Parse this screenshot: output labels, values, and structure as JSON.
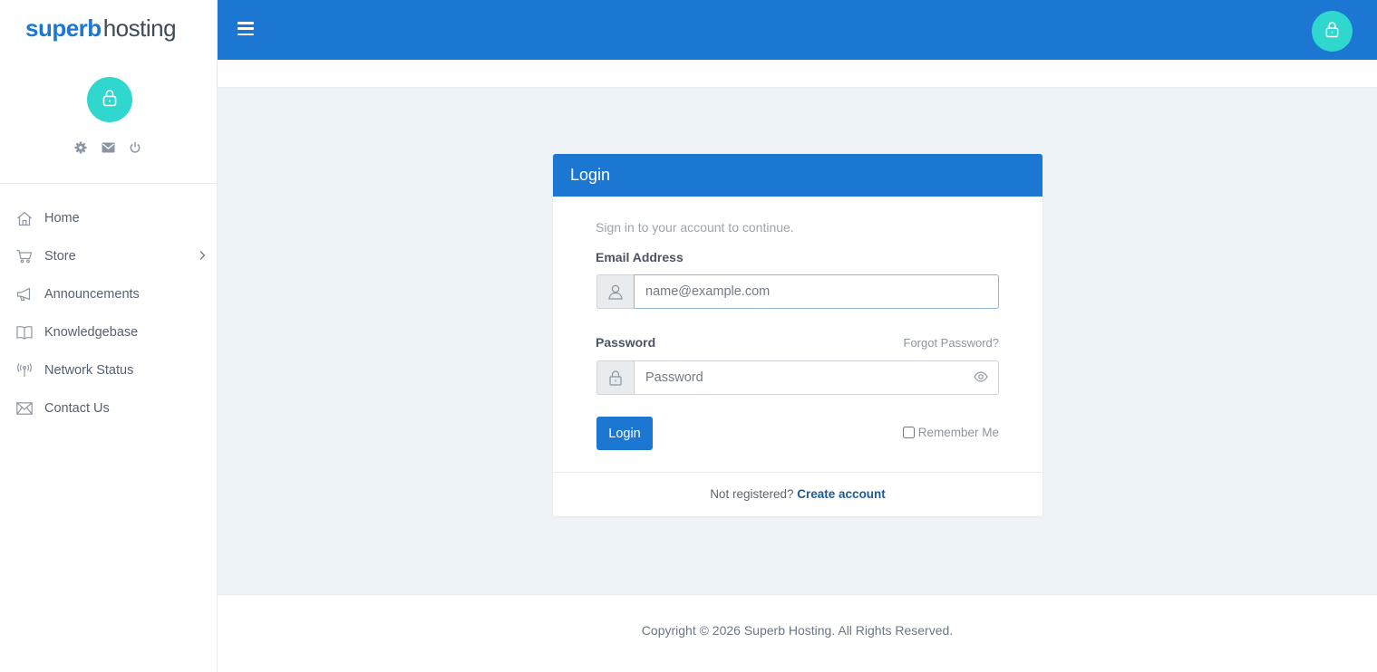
{
  "brand": {
    "part1": "superb",
    "part2": "hosting"
  },
  "colors": {
    "primary": "#1c77d3",
    "avatar": "#2fd7cf",
    "link": "#1d5a96"
  },
  "sidebar": {
    "tools": [
      "gear-icon",
      "mail-icon",
      "power-icon"
    ],
    "items": [
      {
        "label": "Home",
        "icon": "home-icon"
      },
      {
        "label": "Store",
        "icon": "cart-icon",
        "has_submenu": true
      },
      {
        "label": "Announcements",
        "icon": "megaphone-icon"
      },
      {
        "label": "Knowledgebase",
        "icon": "book-icon"
      },
      {
        "label": "Network Status",
        "icon": "signal-tower-icon"
      },
      {
        "label": "Contact Us",
        "icon": "envelope-icon"
      }
    ]
  },
  "login": {
    "title": "Login",
    "subtitle": "Sign in to your account to continue.",
    "email_label": "Email Address",
    "email_placeholder": "name@example.com",
    "email_value": "",
    "password_label": "Password",
    "password_placeholder": "Password",
    "password_value": "",
    "forgot_link": "Forgot Password?",
    "submit_label": "Login",
    "remember_label": "Remember Me",
    "remember_checked": false,
    "not_registered": "Not registered?",
    "create_account": "Create account"
  },
  "footer": {
    "copyright": "Copyright © 2026 Superb Hosting. All Rights Reserved."
  }
}
